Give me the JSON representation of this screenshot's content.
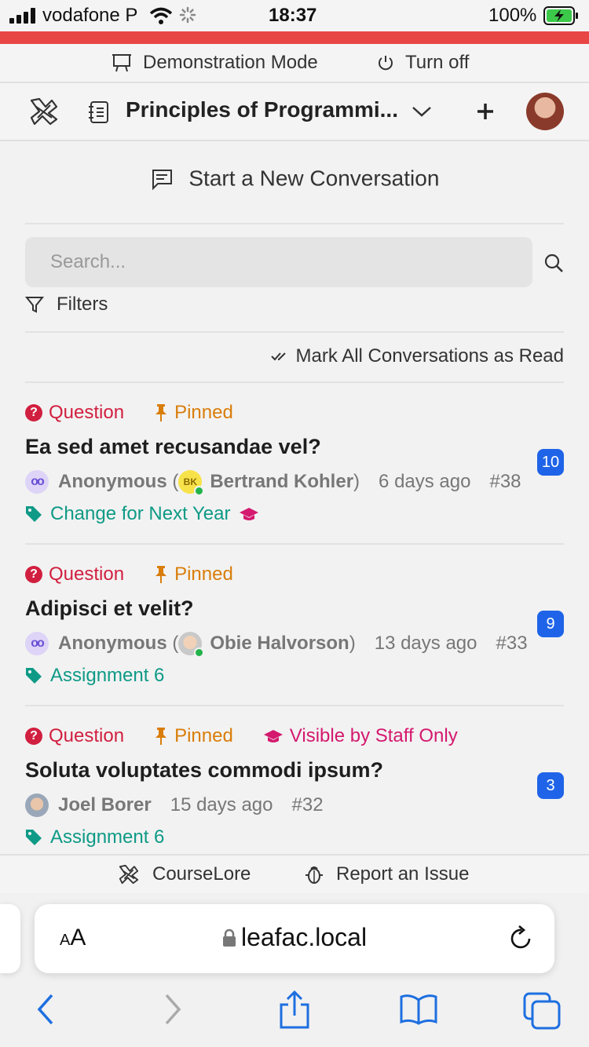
{
  "status_bar": {
    "carrier": "vodafone P",
    "time": "18:37",
    "battery": "100%"
  },
  "demo_bar": {
    "mode_label": "Demonstration Mode",
    "turn_off_label": "Turn off"
  },
  "header": {
    "course_title": "Principles of Programmi..."
  },
  "main": {
    "new_conversation_label": "Start a New Conversation",
    "search_placeholder": "Search...",
    "filters_label": "Filters",
    "mark_all_read_label": "Mark All Conversations as Read"
  },
  "conversations": [
    {
      "tags": {
        "question": "Question",
        "pinned": "Pinned"
      },
      "title": "Ea sed amet recusandae vel?",
      "author": "Anonymous",
      "real_name": "Bertrand Kohler",
      "initials": "BK",
      "time": "6 days ago",
      "number": "#38",
      "tag": "Change for Next Year",
      "unread": "10"
    },
    {
      "tags": {
        "question": "Question",
        "pinned": "Pinned"
      },
      "title": "Adipisci et velit?",
      "author": "Anonymous",
      "real_name": "Obie Halvorson",
      "time": "13 days ago",
      "number": "#33",
      "tag": "Assignment 6",
      "unread": "9"
    },
    {
      "tags": {
        "question": "Question",
        "pinned": "Pinned",
        "staff": "Visible by Staff Only"
      },
      "title": "Soluta voluptates commodi ipsum?",
      "author": "Joel Borer",
      "time": "15 days ago",
      "number": "#32",
      "tag": "Assignment 6",
      "unread": "3"
    }
  ],
  "footer": {
    "brand": "CourseLore",
    "report_label": "Report an Issue"
  },
  "safari": {
    "aa_label": "AA",
    "url": "leafac.local"
  },
  "colors": {
    "accent_red": "#e84545",
    "question": "#d11f3f",
    "pinned": "#d97d0a",
    "staff": "#d4196e",
    "tag": "#0e9a86",
    "badge": "#1f64e8"
  },
  "icons": [
    "signal-icon",
    "wifi-icon",
    "spinner-icon",
    "battery-icon",
    "presentation-icon",
    "power-icon",
    "courselore-logo-icon",
    "journal-icon",
    "chevron-down-icon",
    "plus-icon",
    "chat-icon",
    "search-icon",
    "filter-icon",
    "check-all-icon",
    "question-icon",
    "pin-icon",
    "tag-icon",
    "mortarboard-icon",
    "bug-icon",
    "lock-icon",
    "reload-icon",
    "back-icon",
    "forward-icon",
    "share-icon",
    "bookmarks-icon",
    "tabs-icon"
  ]
}
